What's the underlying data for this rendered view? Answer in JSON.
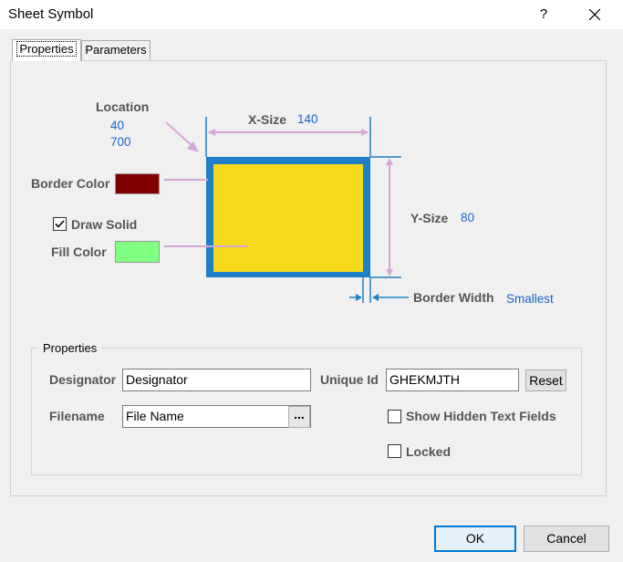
{
  "window": {
    "title": "Sheet Symbol",
    "help_glyph": "?"
  },
  "tabs": [
    {
      "label": "Properties",
      "active": true
    },
    {
      "label": "Parameters",
      "active": false
    }
  ],
  "diagram": {
    "location_label": "Location",
    "location_x": "40",
    "location_y": "700",
    "xsize_label": "X-Size",
    "xsize_value": "140",
    "ysize_label": "Y-Size",
    "ysize_value": "80",
    "border_color_label": "Border Color",
    "border_color": "#800000",
    "draw_solid_label": "Draw Solid",
    "draw_solid_checked": true,
    "fill_color_label": "Fill Color",
    "fill_color": "#80ff80",
    "border_width_label": "Border Width",
    "border_width_value": "Smallest",
    "symbol_border_color": "#1e7fc6",
    "symbol_fill_color": "#f5d91c",
    "dimension_line_color": "#d7a6d7"
  },
  "properties_group": {
    "title": "Properties",
    "designator_label": "Designator",
    "designator_value": "Designator",
    "unique_id_label": "Unique Id",
    "unique_id_value": "GHEKMJTH",
    "reset_label": "Reset",
    "filename_label": "Filename",
    "filename_value": "File Name",
    "browse_label": "...",
    "show_hidden_label": "Show Hidden Text Fields",
    "show_hidden_checked": false,
    "locked_label": "Locked",
    "locked_checked": false
  },
  "footer": {
    "ok_label": "OK",
    "cancel_label": "Cancel"
  }
}
